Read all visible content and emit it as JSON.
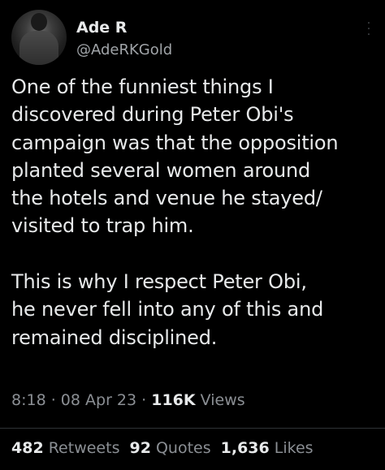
{
  "author": {
    "display_name": "Ade R",
    "handle": "@AdeRKGold"
  },
  "tweet": {
    "text": "One of the funniest things I\ndiscovered during Peter Obi's\ncampaign was that the opposition\nplanted several women around\nthe hotels and venue he stayed/\nvisited to trap him.\n\nThis is why I respect Peter Obi,\nhe never fell into any of this and\nremained disciplined."
  },
  "meta": {
    "time": "8:18",
    "separator": " · ",
    "date": "08 Apr 23",
    "views_count": "116K",
    "views_label": " Views"
  },
  "stats": {
    "retweets_count": "482",
    "retweets_label": " Retweets",
    "quotes_count": "92",
    "quotes_label": " Quotes",
    "likes_count": "1,636",
    "likes_label": " Likes"
  },
  "icons": {
    "more": "more-vertical-icon"
  },
  "colors": {
    "background": "#000000",
    "primary_text": "#e7e9ea",
    "secondary_text": "#8b8f94",
    "divider": "#2f3336"
  }
}
